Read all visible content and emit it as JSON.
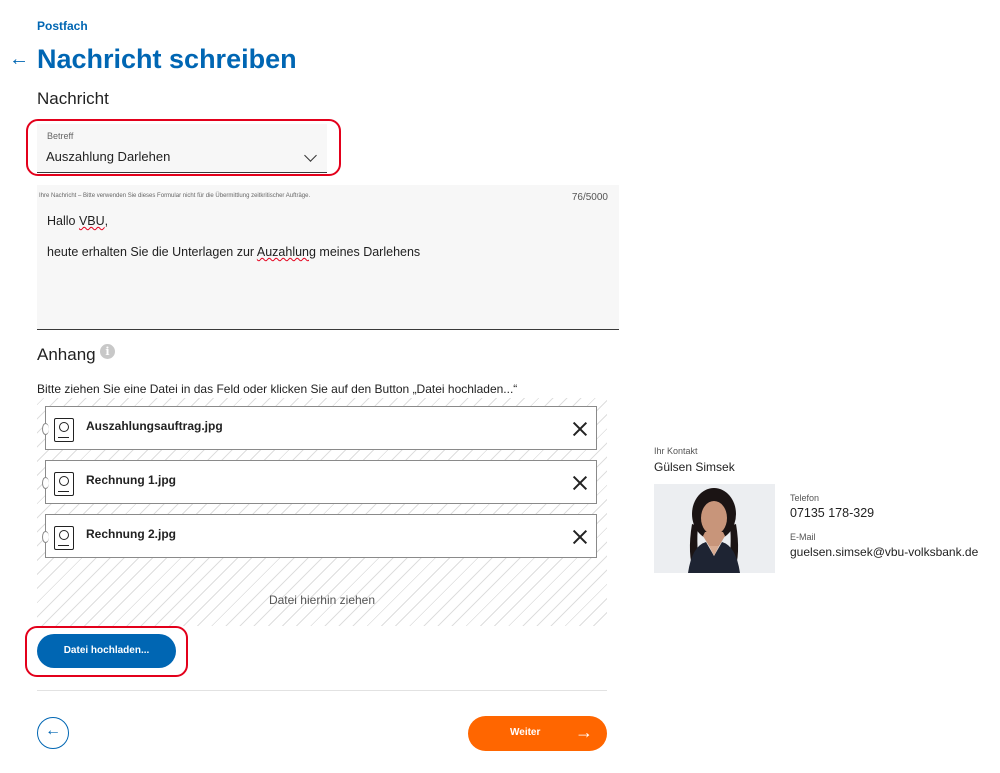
{
  "header": {
    "breadcrumb": "Postfach",
    "back_icon": "arrow-left-icon",
    "title": "Nachricht schreiben",
    "section_title": "Nachricht"
  },
  "subject_select": {
    "label": "Betreff",
    "value": "Auszahlung Darlehen",
    "icon": "chevron-down-icon"
  },
  "message": {
    "hint": "Ihre Nachricht – Bitte verwenden Sie dieses Formular nicht für die Übermittlung zeitkritischer Aufträge.",
    "counter": "76/5000",
    "line1_prefix": "Hallo ",
    "line1_word": "VBU",
    "line1_suffix": ",",
    "line2_prefix": "heute erhalten Sie die Unterlagen zur ",
    "line2_word": "Auzahlung",
    "line2_suffix": " meines Darlehens"
  },
  "attachments": {
    "title": "Anhang",
    "info_icon": "info-icon",
    "instruction": "Bitte ziehen Sie eine Datei in das Feld oder klicken Sie auf den Button „Datei hochladen...“",
    "files": [
      {
        "name": "Auszahlungsauftrag.jpg"
      },
      {
        "name": "Rechnung 1.jpg"
      },
      {
        "name": "Rechnung 2.jpg"
      }
    ],
    "drop_hint": "Datei hierhin ziehen",
    "upload_label": "Datei hochladen..."
  },
  "footer": {
    "back_icon": "arrow-left-circle-icon",
    "next_label": "Weiter",
    "next_icon": "arrow-right-icon"
  },
  "contact": {
    "kicker": "Ihr Kontakt",
    "name": "Gülsen Simsek",
    "phone_label": "Telefon",
    "phone": "07135 178-329",
    "email_label": "E-Mail",
    "email": "guelsen.simsek@vbu-volksbank.de"
  },
  "colors": {
    "brand_blue": "#0066b3",
    "action_orange": "#ff6600",
    "highlight_red": "#e3001b"
  }
}
